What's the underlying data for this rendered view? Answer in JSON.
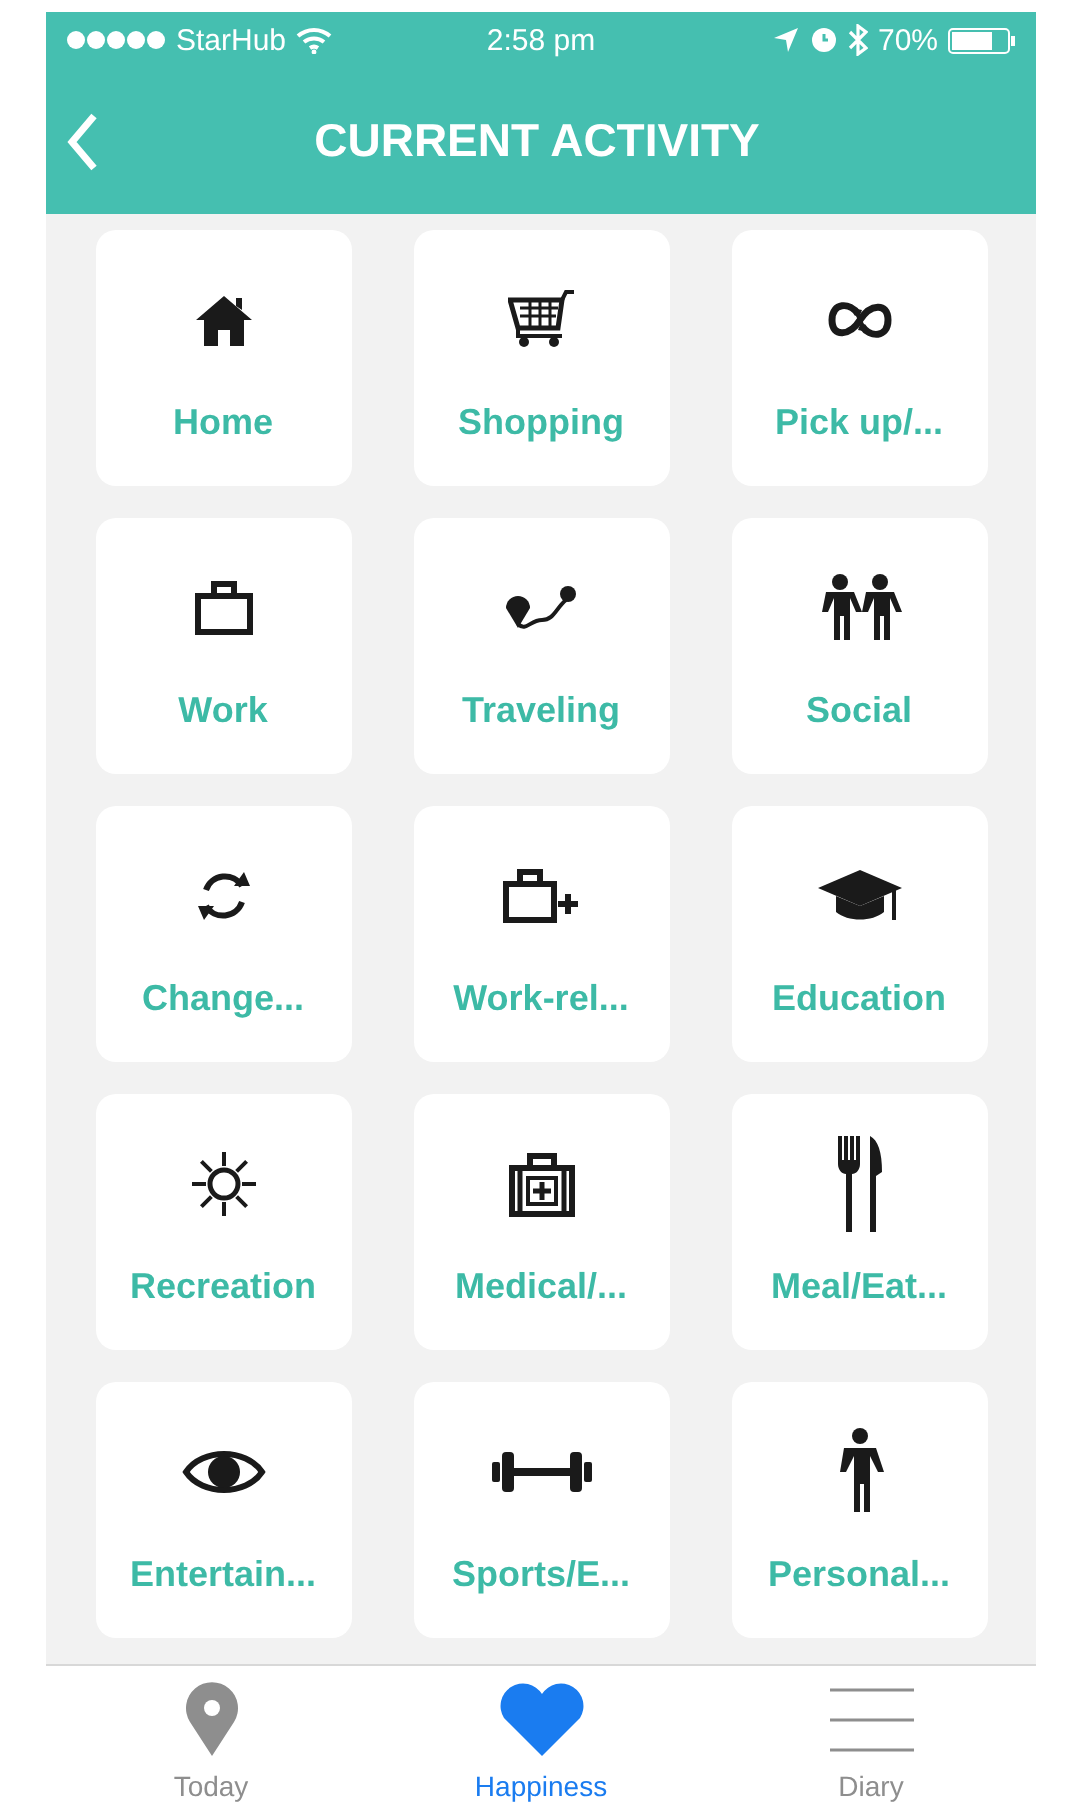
{
  "status_bar": {
    "carrier": "StarHub",
    "time": "2:58 pm",
    "battery": "70%"
  },
  "nav": {
    "title": "CURRENT ACTIVITY"
  },
  "activities": [
    {
      "label": "Home"
    },
    {
      "label": "Shopping"
    },
    {
      "label": "Pick up/..."
    },
    {
      "label": "Work"
    },
    {
      "label": "Traveling"
    },
    {
      "label": "Social"
    },
    {
      "label": "Change..."
    },
    {
      "label": "Work-rel..."
    },
    {
      "label": "Education"
    },
    {
      "label": "Recreation"
    },
    {
      "label": "Medical/..."
    },
    {
      "label": "Meal/Eat..."
    },
    {
      "label": "Entertain..."
    },
    {
      "label": "Sports/E..."
    },
    {
      "label": "Personal..."
    }
  ],
  "tabs": [
    {
      "label": "Today",
      "selected": false
    },
    {
      "label": "Happiness",
      "selected": true
    },
    {
      "label": "Diary",
      "selected": false
    }
  ]
}
